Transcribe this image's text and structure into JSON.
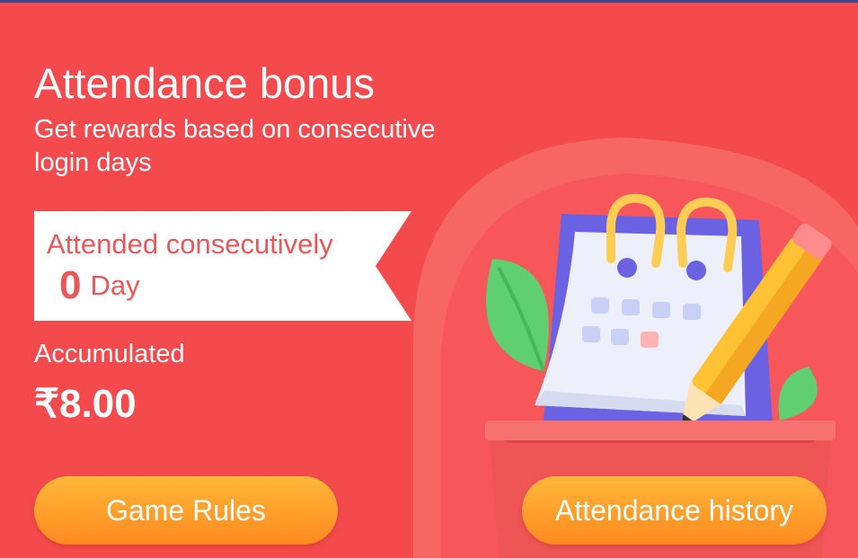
{
  "card": {
    "title": "Attendance bonus",
    "subtitle": "Get rewards based on consecutive login days"
  },
  "streak": {
    "text_before": "Attended consecutively",
    "days": "0",
    "text_after": "Day"
  },
  "accumulated": {
    "label": "Accumulated",
    "amount": "₹8.00"
  },
  "buttons": {
    "rules": "Game Rules",
    "history": "Attendance history"
  },
  "illustration": {
    "icon": "calendar-pencil-icon"
  },
  "colors": {
    "background": "#f54a4d",
    "button": "#ff9d2b",
    "ribbon_text": "#e8585a"
  }
}
